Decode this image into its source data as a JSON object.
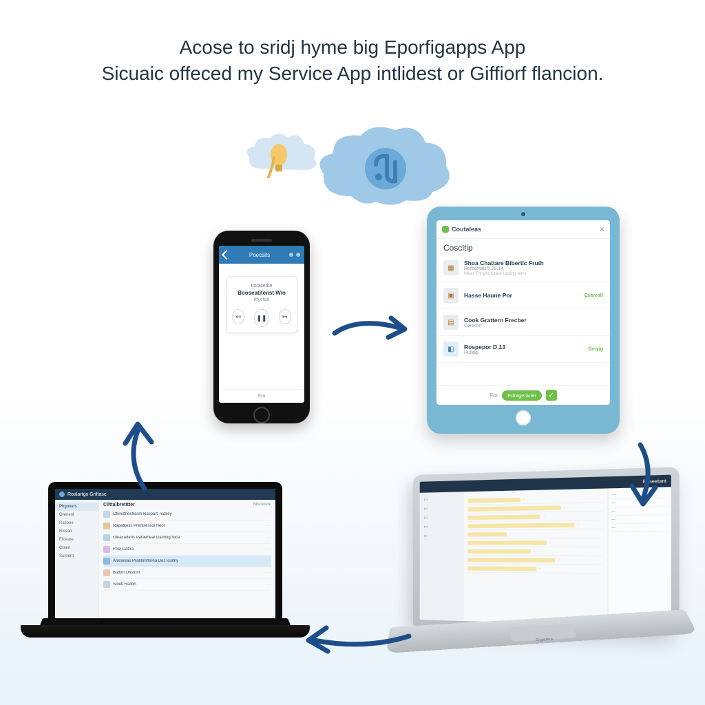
{
  "headline": {
    "line1": "Acose to sridj hyme big Eporfigapps App",
    "line2": "Sicuaic offeced my Service App intlidest or Giffiorf flancion."
  },
  "phone": {
    "topbar_title": "Poecsits",
    "card_eyebrow": "Intracethe",
    "card_title": "Booseatitenst Wio",
    "card_sub": "Itfyetad",
    "footer": "Fra"
  },
  "tablet": {
    "brand": "Coutaleas",
    "close": "×",
    "title": "Coscltip",
    "rows": [
      {
        "a": "Shoa Chattare Bibertic Fruth",
        "b": "Refechtatt 5.28.14",
        "c": "Mear Thrighotutare lacting terrs",
        "tag": ""
      },
      {
        "a": "Hasse Haune Por",
        "b": "",
        "c": "",
        "tag": "Esarealt"
      },
      {
        "a": "Cook Grattern Frecber",
        "b": "Cereron",
        "c": "",
        "tag": ""
      },
      {
        "a": "Rospepor D.13",
        "b": "Hulldg",
        "c": "",
        "tag": "Ceryig"
      }
    ],
    "foot_left": "For",
    "foot_pill": "Edragerarier",
    "foot_check": "✓"
  },
  "laptop_left": {
    "window_title": "Roalartgo Griftase",
    "sidebar": [
      "Phgoners",
      "Orenent",
      "Ratione",
      "Rissan",
      "Efceare",
      "Otaen",
      "Soroent"
    ],
    "section_title": "Cilttalbretitter",
    "section_sub": "Nbeonere",
    "rows": [
      "Otkrelthesfrasm Rasoart Todkey",
      "Rapatkess Prentilessol Heor",
      "Oleacadens Pataerteal Oatirdig Nice",
      "Ffrel Dattra",
      "Aneskeas Prablontforea DesTositny",
      "Buttint Ofistom",
      "Sinetl Rallon"
    ]
  },
  "laptop_right": {
    "top_left": "",
    "top_right": "Baseetant",
    "nav": [
      "",
      "",
      "",
      "",
      ""
    ],
    "mid_title": "",
    "panel_title": "",
    "brand": "Sgales"
  },
  "icons": {
    "cloud_small": "lightbulb-cloud-icon",
    "cloud_big": "data-cloud-icon",
    "phone_back": "back-icon",
    "phone_prev": "previous-icon",
    "phone_play": "play-pause-icon",
    "phone_next": "next-icon",
    "tablet_close": "close-icon",
    "tablet_check": "check-icon"
  },
  "colors": {
    "accent_blue": "#1d4e89",
    "cloud_blue": "#9fc9e6",
    "tablet_body": "#79b8d3",
    "green": "#6fbf4b"
  }
}
